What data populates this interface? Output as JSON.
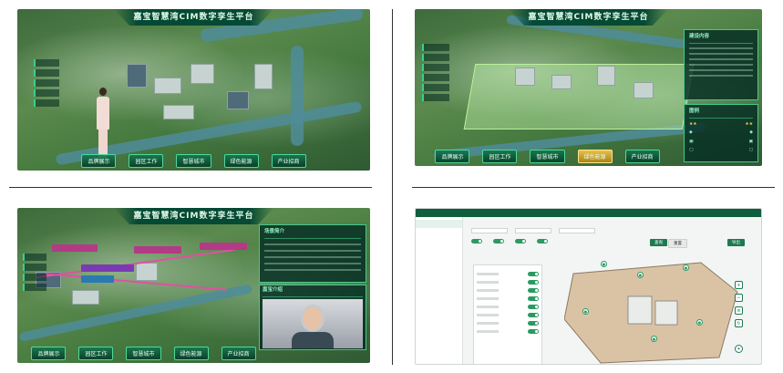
{
  "panel1": {
    "title": "嘉宝智慧湾CIM数字孪生平台",
    "bottom_buttons": [
      "品牌展示",
      "园区工作",
      "智慧城市",
      "绿色能源",
      "产业招商"
    ]
  },
  "panel2": {
    "title": "嘉宝智慧湾CIM数字孪生平台",
    "info_header": "建设内容",
    "legend_header": "图例",
    "bottom_buttons": [
      "品牌展示",
      "园区工作",
      "智慧城市",
      "绿色能源",
      "产业招商"
    ]
  },
  "panel3": {
    "title": "嘉宝智慧湾CIM数字孪生平台",
    "info_header": "场景简介",
    "video_header": "嘉宝介绍",
    "bottom_buttons": [
      "品牌展示",
      "园区工作",
      "智慧城市",
      "绿色能源",
      "产业招商"
    ]
  },
  "panel4": {
    "search_button": "查询",
    "reset_button": "重置",
    "action_button": "导出"
  }
}
